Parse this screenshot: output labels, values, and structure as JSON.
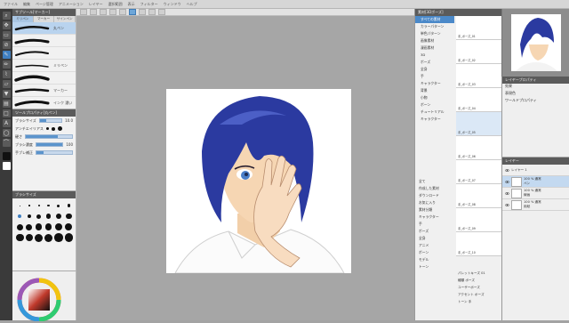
{
  "titlebar": {
    "items": [
      "ファイル",
      "編集",
      "ページ管理",
      "アニメーション",
      "レイヤー",
      "選択範囲",
      "表示",
      "フィルター",
      "ウィンドウ",
      "ヘルプ"
    ]
  },
  "subtool": {
    "title": "サブツール[マーカー]",
    "tabs": [
      "ミリペン",
      "マーカー",
      "サインペン"
    ],
    "brushes": [
      "丸ペン",
      "",
      "",
      "ミリペン",
      "",
      "マーカー",
      "インク 濃い"
    ]
  },
  "toolprop": {
    "title": "ツールプロパティ[丸ペン]",
    "rows": [
      "ブラシサイズ",
      "アンチエイリアス",
      "硬さ",
      "ブラシ濃度",
      "手ブレ補正"
    ],
    "values": {
      "brush_size": "10.0",
      "density": "100"
    }
  },
  "brushsize": {
    "title": "ブラシサイズ"
  },
  "material": {
    "title": "素材[3Dポーズ]",
    "tree": [
      "すべての素材",
      "カラーパターン",
      "単色パターン",
      "画像素材",
      "漫画素材",
      "3D",
      "ポーズ",
      "全身",
      "手",
      "キャラクター",
      "背景",
      "小物",
      "ボーン",
      "チュートリアル",
      "キャラクター"
    ],
    "thumbs": [
      "手_ポーズ_01",
      "手_ポーズ_02",
      "手_ポーズ_03",
      "手_ポーズ_04",
      "手_ポーズ_05",
      "手_ポーズ_06",
      "手_ポーズ_07",
      "手_ポーズ_08",
      "手_ポーズ_09",
      "手_ポーズ_10"
    ],
    "list": [
      "全て",
      "作成した素材",
      "ダウンロード",
      "お気に入り",
      "素材分類",
      "キャラクター",
      "手",
      "ポーズ",
      "全身",
      "アニメ",
      "ボーン",
      "モデル",
      "トーン"
    ],
    "props": [
      "パレットキーズ 01",
      "種類 ポーズ",
      "ユーザーポーズ",
      "アクセント ポーズ",
      "トーン 手"
    ]
  },
  "layerprop": {
    "title": "レイヤープロパティ",
    "items": [
      "効果",
      "表現色",
      "ワールドプロパティ"
    ]
  },
  "layers": {
    "title": "レイヤー",
    "items": [
      "レイヤー 1",
      "100 % 通常",
      "ペン",
      "100 % 通常",
      "線画",
      "100 % 通常",
      "用紙"
    ]
  },
  "colors": {
    "accent": "#3f7fc1",
    "hair": "#2b3aa0"
  }
}
